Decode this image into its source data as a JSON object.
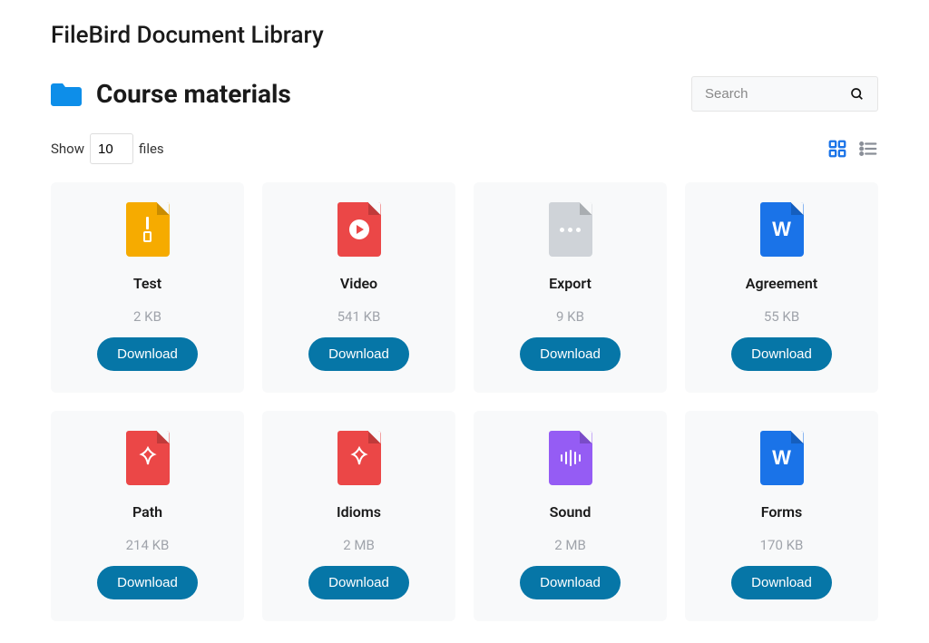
{
  "page_title": "FileBird Document Library",
  "folder": {
    "name": "Course materials"
  },
  "search": {
    "placeholder": "Search"
  },
  "show": {
    "label_before": "Show",
    "value": "10",
    "label_after": "files"
  },
  "download_label": "Download",
  "files": [
    {
      "name": "Test",
      "size": "2 KB",
      "type": "zip"
    },
    {
      "name": "Video",
      "size": "541 KB",
      "type": "video"
    },
    {
      "name": "Export",
      "size": "9 KB",
      "type": "generic"
    },
    {
      "name": "Agreement",
      "size": "55 KB",
      "type": "word"
    },
    {
      "name": "Path",
      "size": "214 KB",
      "type": "pdf"
    },
    {
      "name": "Idioms",
      "size": "2 MB",
      "type": "pdf"
    },
    {
      "name": "Sound",
      "size": "2 MB",
      "type": "audio"
    },
    {
      "name": "Forms",
      "size": "170 KB",
      "type": "word"
    }
  ],
  "colors": {
    "accent": "#0676a7",
    "folder": "#0d8ee9"
  }
}
